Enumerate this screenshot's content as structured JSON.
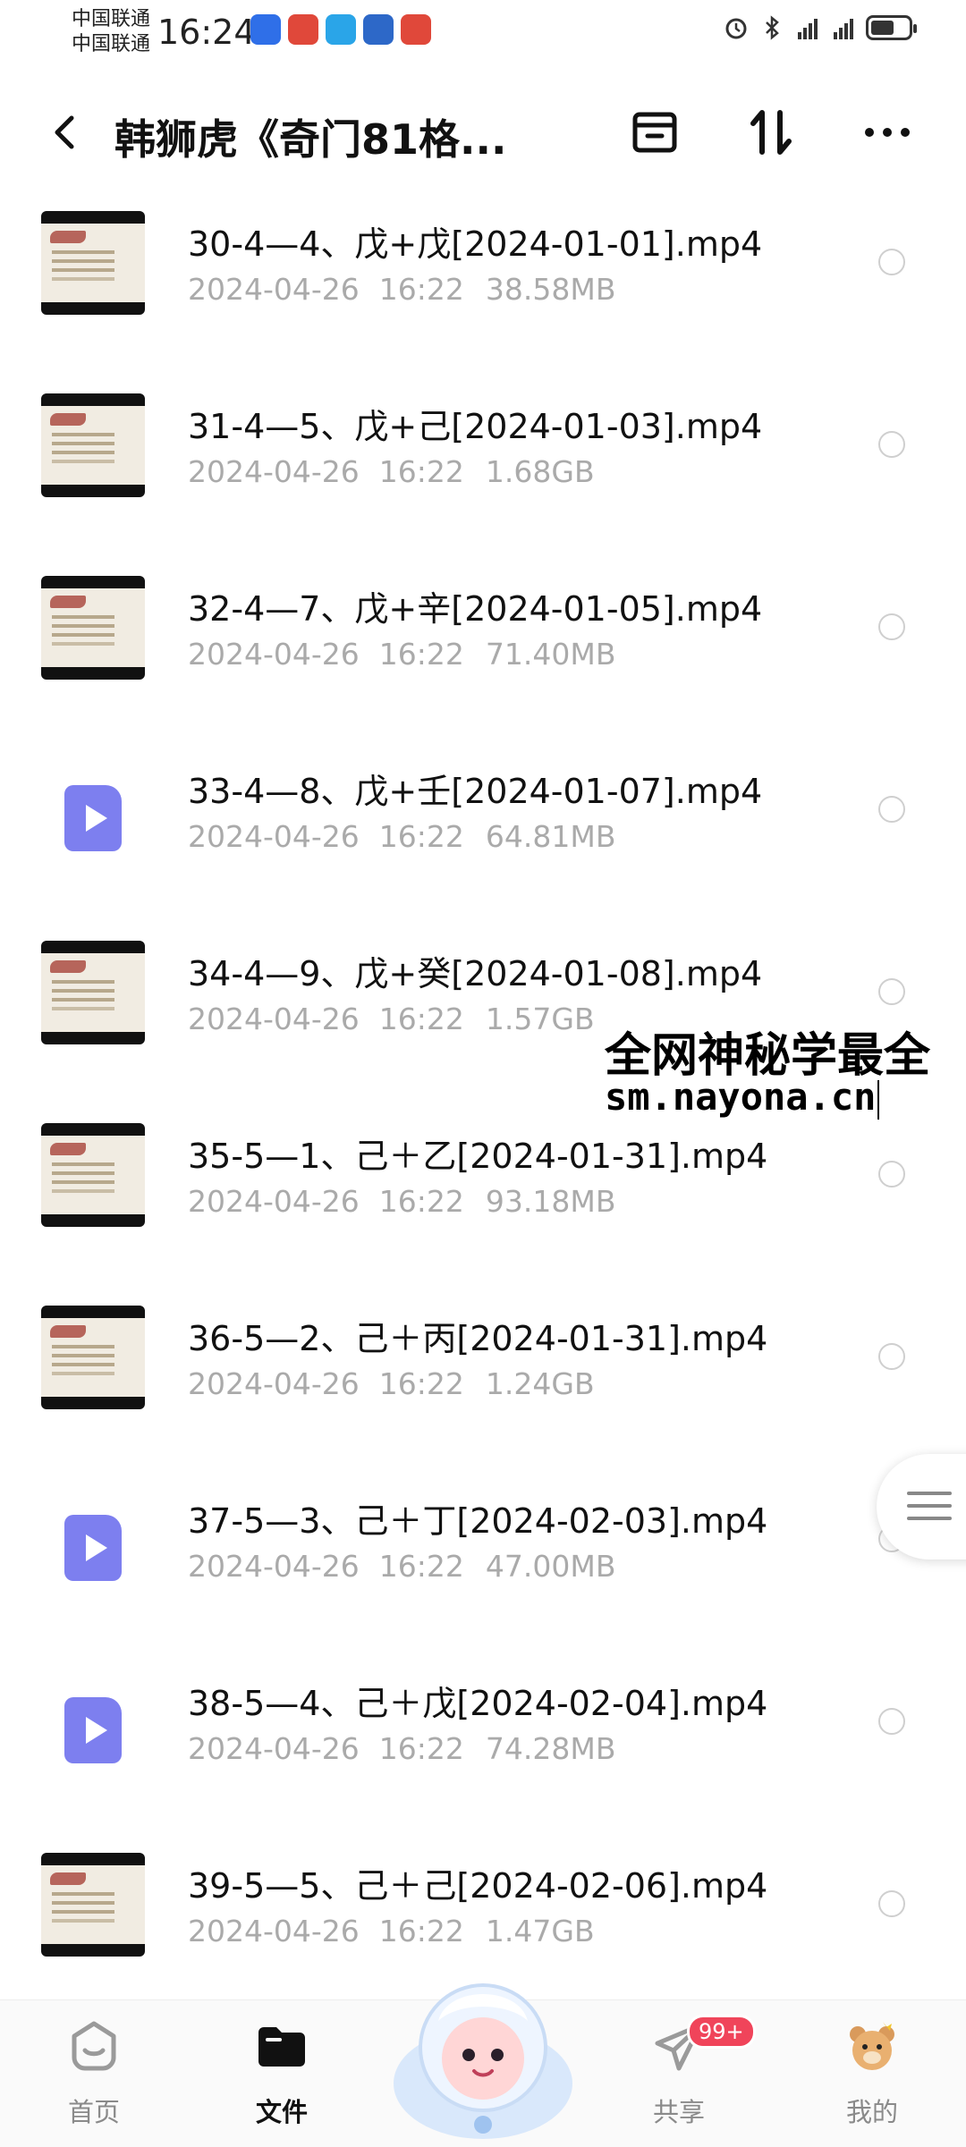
{
  "status_bar": {
    "carrier_1": "中国联通",
    "carrier_2": "中国联通",
    "time": "16:24"
  },
  "header": {
    "title": "韩狮虎《奇门81格..."
  },
  "files": [
    {
      "name": "30-4—4、戊+戊[2024-01-01].mp4",
      "date": "2024-04-26",
      "time": "16:22",
      "size": "38.58MB",
      "thumb": "image"
    },
    {
      "name": "31-4—5、戊+己[2024-01-03].mp4",
      "date": "2024-04-26",
      "time": "16:22",
      "size": "1.68GB",
      "thumb": "image"
    },
    {
      "name": "32-4—7、戊+辛[2024-01-05].mp4",
      "date": "2024-04-26",
      "time": "16:22",
      "size": "71.40MB",
      "thumb": "image"
    },
    {
      "name": "33-4—8、戊+壬[2024-01-07].mp4",
      "date": "2024-04-26",
      "time": "16:22",
      "size": "64.81MB",
      "thumb": "video-icon"
    },
    {
      "name": "34-4—9、戊+癸[2024-01-08].mp4",
      "date": "2024-04-26",
      "time": "16:22",
      "size": "1.57GB",
      "thumb": "image"
    },
    {
      "name": "35-5—1、己＋乙[2024-01-31].mp4",
      "date": "2024-04-26",
      "time": "16:22",
      "size": "93.18MB",
      "thumb": "image"
    },
    {
      "name": "36-5—2、己＋丙[2024-01-31].mp4",
      "date": "2024-04-26",
      "time": "16:22",
      "size": "1.24GB",
      "thumb": "image"
    },
    {
      "name": "37-5—3、己＋丁[2024-02-03].mp4",
      "date": "2024-04-26",
      "time": "16:22",
      "size": "47.00MB",
      "thumb": "video-icon"
    },
    {
      "name": "38-5—4、己＋戊[2024-02-04].mp4",
      "date": "2024-04-26",
      "time": "16:22",
      "size": "74.28MB",
      "thumb": "video-icon"
    },
    {
      "name": "39-5—5、己＋己[2024-02-06].mp4",
      "date": "2024-04-26",
      "time": "16:22",
      "size": "1.47GB",
      "thumb": "image"
    }
  ],
  "watermark": {
    "line1": "全网神秘学最全",
    "line2": "sm.nayona.cn"
  },
  "bottom_nav": {
    "home": "首页",
    "files": "文件",
    "share": "共享",
    "share_badge": "99+",
    "mine": "我的"
  },
  "colors": {
    "accent_video": "#7d7fef",
    "badge": "#f0445a",
    "meta_text": "#aaaaaa"
  }
}
